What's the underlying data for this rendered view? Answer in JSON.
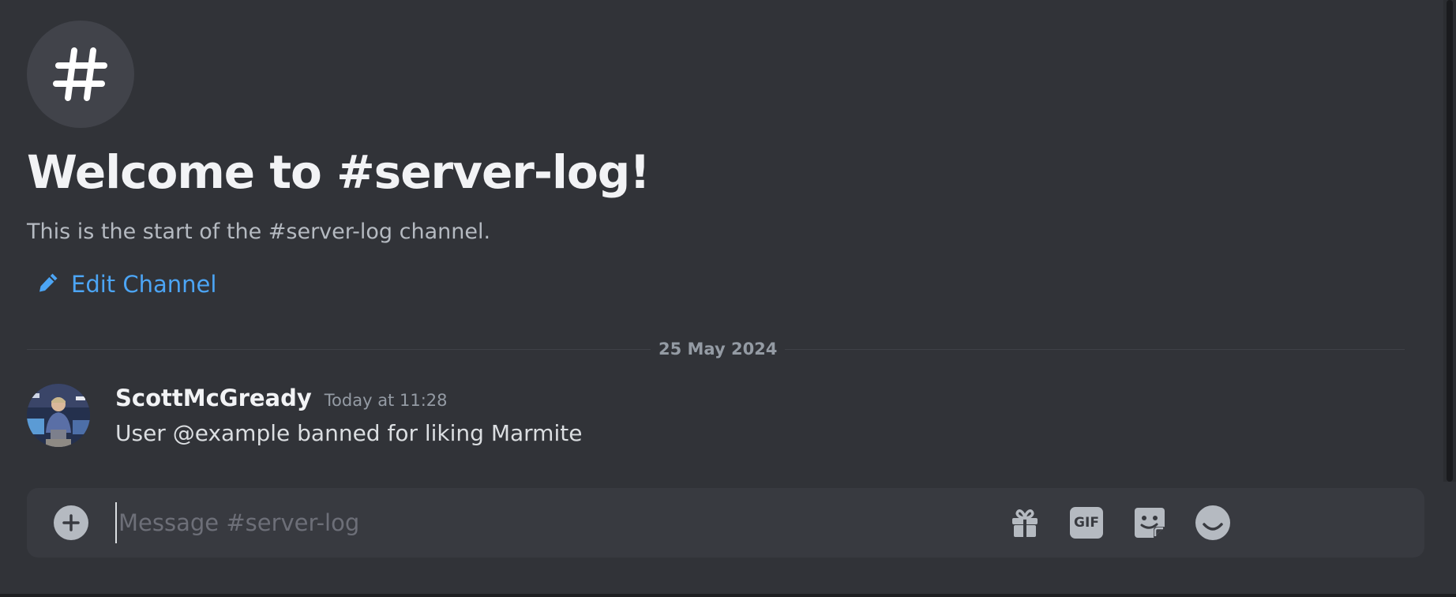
{
  "channel": {
    "icon": "hash-icon",
    "welcome_title": "Welcome to #server-log!",
    "welcome_subtitle": "This is the start of the #server-log channel.",
    "edit_label": "Edit Channel",
    "edit_icon": "pencil-icon"
  },
  "divider": {
    "date": "25 May 2024"
  },
  "message": {
    "author": "ScottMcGready",
    "timestamp": "Today at 11:28",
    "text": "User @example banned for liking Marmite"
  },
  "composer": {
    "placeholder": "Message #server-log",
    "add_icon": "plus-circle-icon",
    "gift_icon": "gift-icon",
    "gif_label": "GIF",
    "sticker_icon": "sticker-icon",
    "emoji_icon": "emoji-icon"
  },
  "colors": {
    "background": "#313338",
    "link": "#4ca5f5",
    "composer_bg": "#383a40"
  }
}
